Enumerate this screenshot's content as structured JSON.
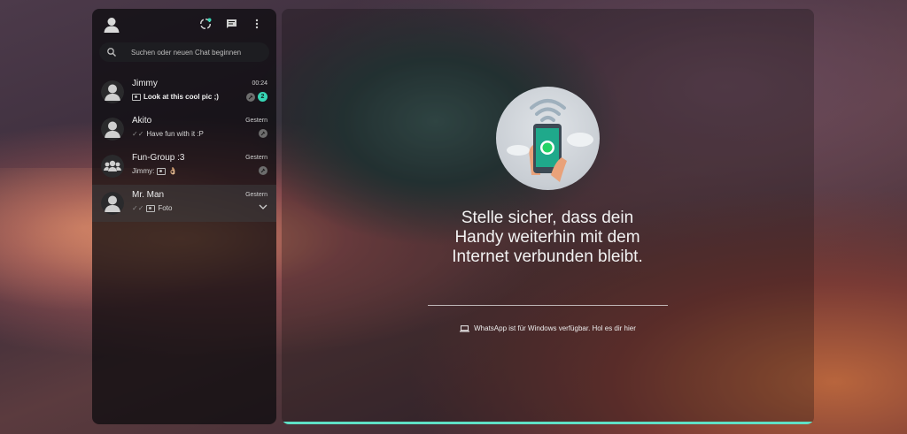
{
  "search": {
    "placeholder": "Suchen oder neuen Chat beginnen"
  },
  "chats": [
    {
      "name": "Jimmy",
      "time": "00:24",
      "preview": "Look at this cool pic ;)",
      "unread": "2"
    },
    {
      "name": "Akito",
      "time": "Gestern",
      "preview": "Have fun with it :P"
    },
    {
      "name": "Fun-Group :3",
      "time": "Gestern",
      "sender": "Jimmy:",
      "emoji": "👌🏼"
    },
    {
      "name": "Mr. Man",
      "time": "Gestern",
      "preview": "Foto"
    }
  ],
  "main": {
    "message_line1": "Stelle sicher, dass dein",
    "message_line2": "Handy weiterhin mit dem",
    "message_line3": "Internet verbunden bleibt.",
    "windows_note": "WhatsApp ist für Windows verfügbar. Hol es dir hier"
  },
  "icons": {
    "header": [
      "avatar-icon",
      "status-icon",
      "new-chat-icon",
      "menu-icon"
    ],
    "search": "search-icon",
    "windows_note": "laptop-icon"
  },
  "colors": {
    "accent": "#36d6b5",
    "progress": "#5fe0c6"
  }
}
